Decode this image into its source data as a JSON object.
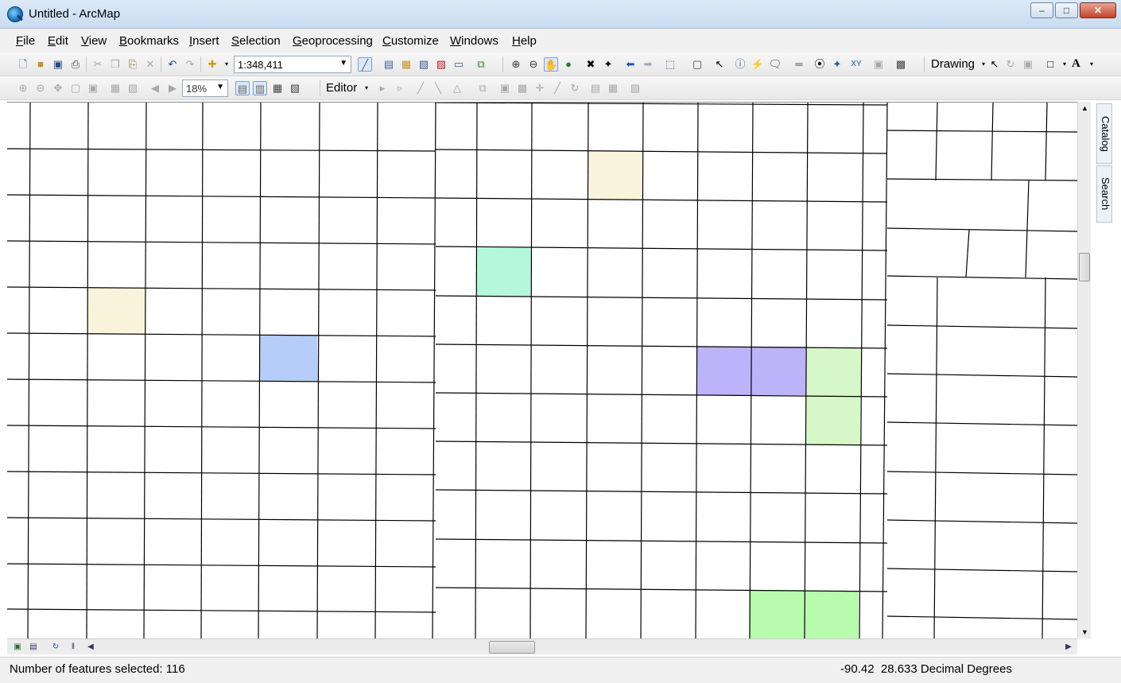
{
  "window": {
    "title": "Untitled - ArcMap"
  },
  "menu": [
    "File",
    "Edit",
    "View",
    "Bookmarks",
    "Insert",
    "Selection",
    "Geoprocessing",
    "Customize",
    "Windows",
    "Help"
  ],
  "toolbar": {
    "scale": "1:348,411",
    "zoom_percent": "18%",
    "editor_label": "Editor",
    "drawing_label": "Drawing",
    "font_label": "A"
  },
  "side_tabs": [
    "Catalog",
    "Search"
  ],
  "status": {
    "selected": "Number of features selected: 116",
    "coords": "-90.42  28.633 Decimal Degrees"
  },
  "colors": {
    "beige": "#faf3dc",
    "mint": "#b5f7d9",
    "blue": "#b6cdfa",
    "purple": "#bcb3fa",
    "lightgreen": "#d6f8c8",
    "green": "#b8fbae"
  }
}
